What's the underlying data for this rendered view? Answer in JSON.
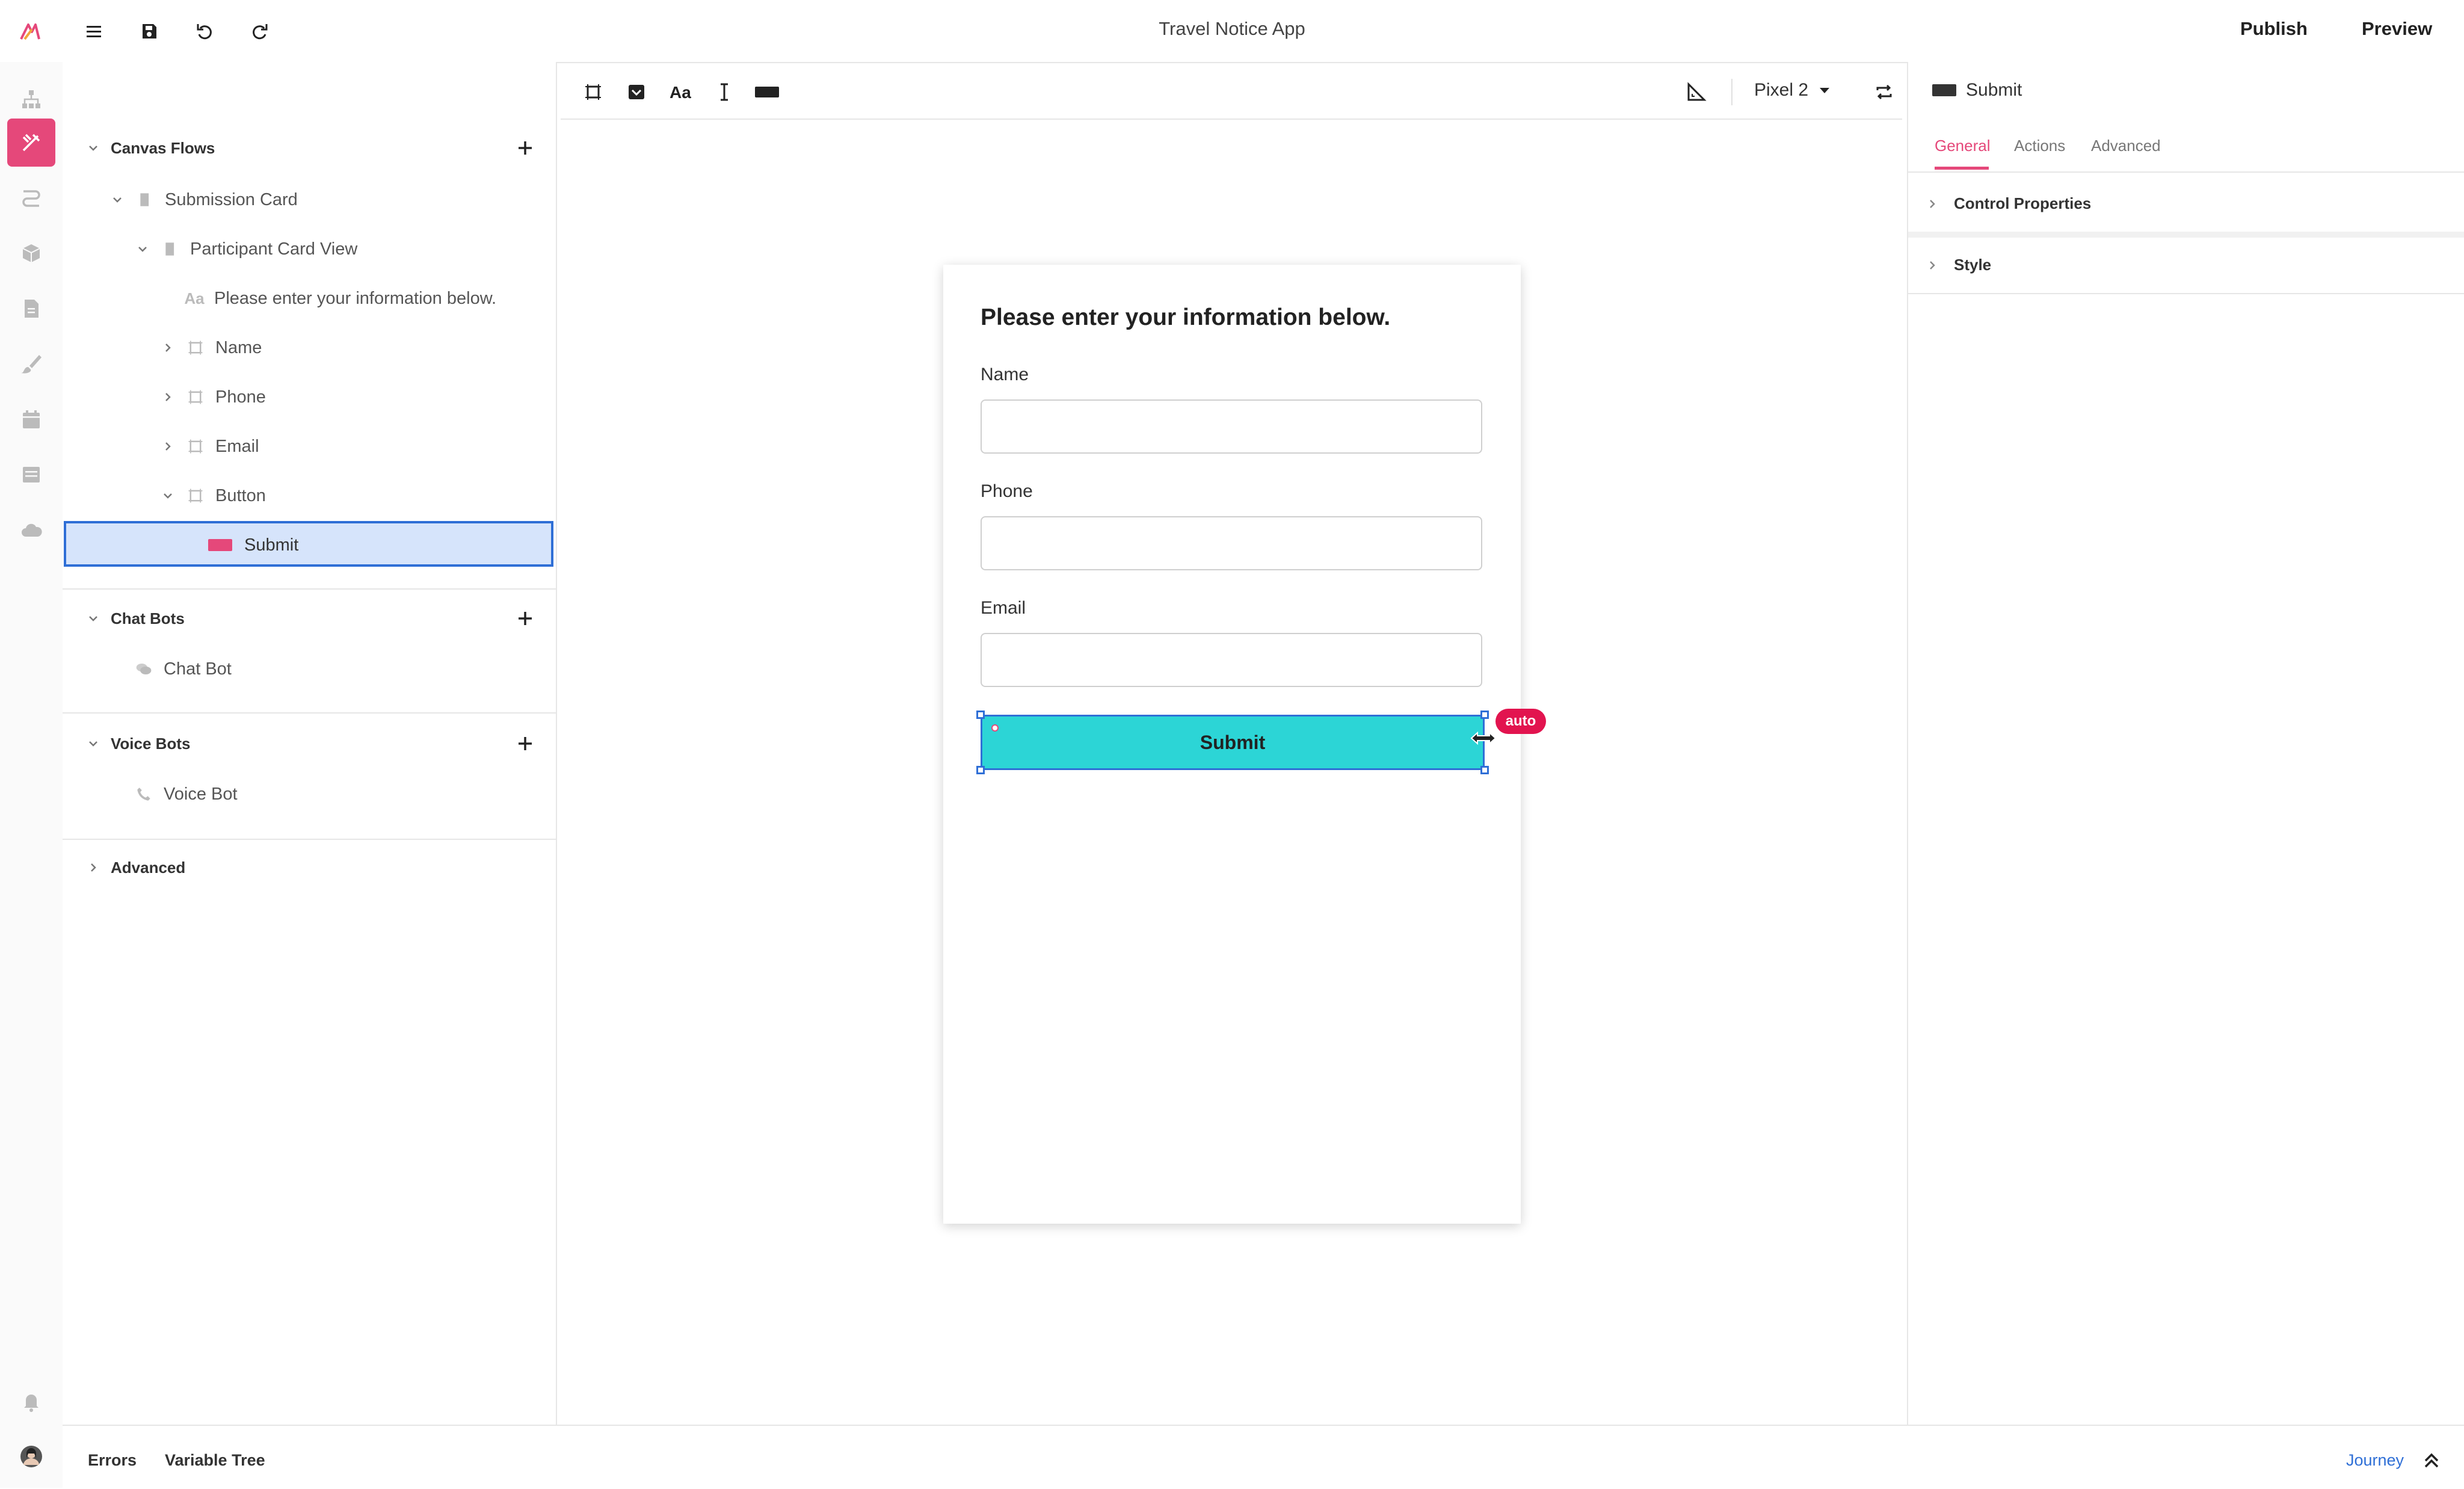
{
  "header": {
    "app_title": "Travel Notice App",
    "publish_label": "Publish",
    "preview_label": "Preview"
  },
  "rail": {
    "items": [
      "flow-icon",
      "design-icon",
      "routing-icon",
      "box-icon",
      "document-icon",
      "brush-icon",
      "calendar-icon",
      "table-icon",
      "cloud-icon"
    ],
    "active_index": 1,
    "accent": "#e5487a"
  },
  "left_panel": {
    "canvas_flows": {
      "title": "Canvas Flows",
      "tree": [
        {
          "label": "Submission Card",
          "level": 1
        },
        {
          "label": "Participant Card View",
          "level": 2
        },
        {
          "label": "Please enter your information below.",
          "level": 3,
          "icon_text": "Aa"
        },
        {
          "label": "Name",
          "level": 3
        },
        {
          "label": "Phone",
          "level": 3
        },
        {
          "label": "Email",
          "level": 3
        },
        {
          "label": "Button",
          "level": 3
        },
        {
          "label": "Submit",
          "level": 4,
          "selected": true
        }
      ]
    },
    "chat_bots": {
      "title": "Chat Bots",
      "items": [
        "Chat Bot"
      ]
    },
    "voice_bots": {
      "title": "Voice Bots",
      "items": [
        "Voice Bot"
      ]
    },
    "advanced": {
      "title": "Advanced"
    }
  },
  "canvas": {
    "device_label": "Pixel 2",
    "form": {
      "heading": "Please enter your information below.",
      "fields": [
        "Name",
        "Phone",
        "Email"
      ],
      "submit_label": "Submit",
      "submit_color": "#2cd5d6",
      "auto_badge": "auto"
    }
  },
  "right_panel": {
    "title": "Submit",
    "tabs": [
      "General",
      "Actions",
      "Advanced"
    ],
    "active_tab": "General",
    "sections": [
      "Control Properties",
      "Style"
    ]
  },
  "bottom_bar": {
    "items": [
      "Errors",
      "Variable Tree"
    ],
    "journey_label": "Journey"
  }
}
